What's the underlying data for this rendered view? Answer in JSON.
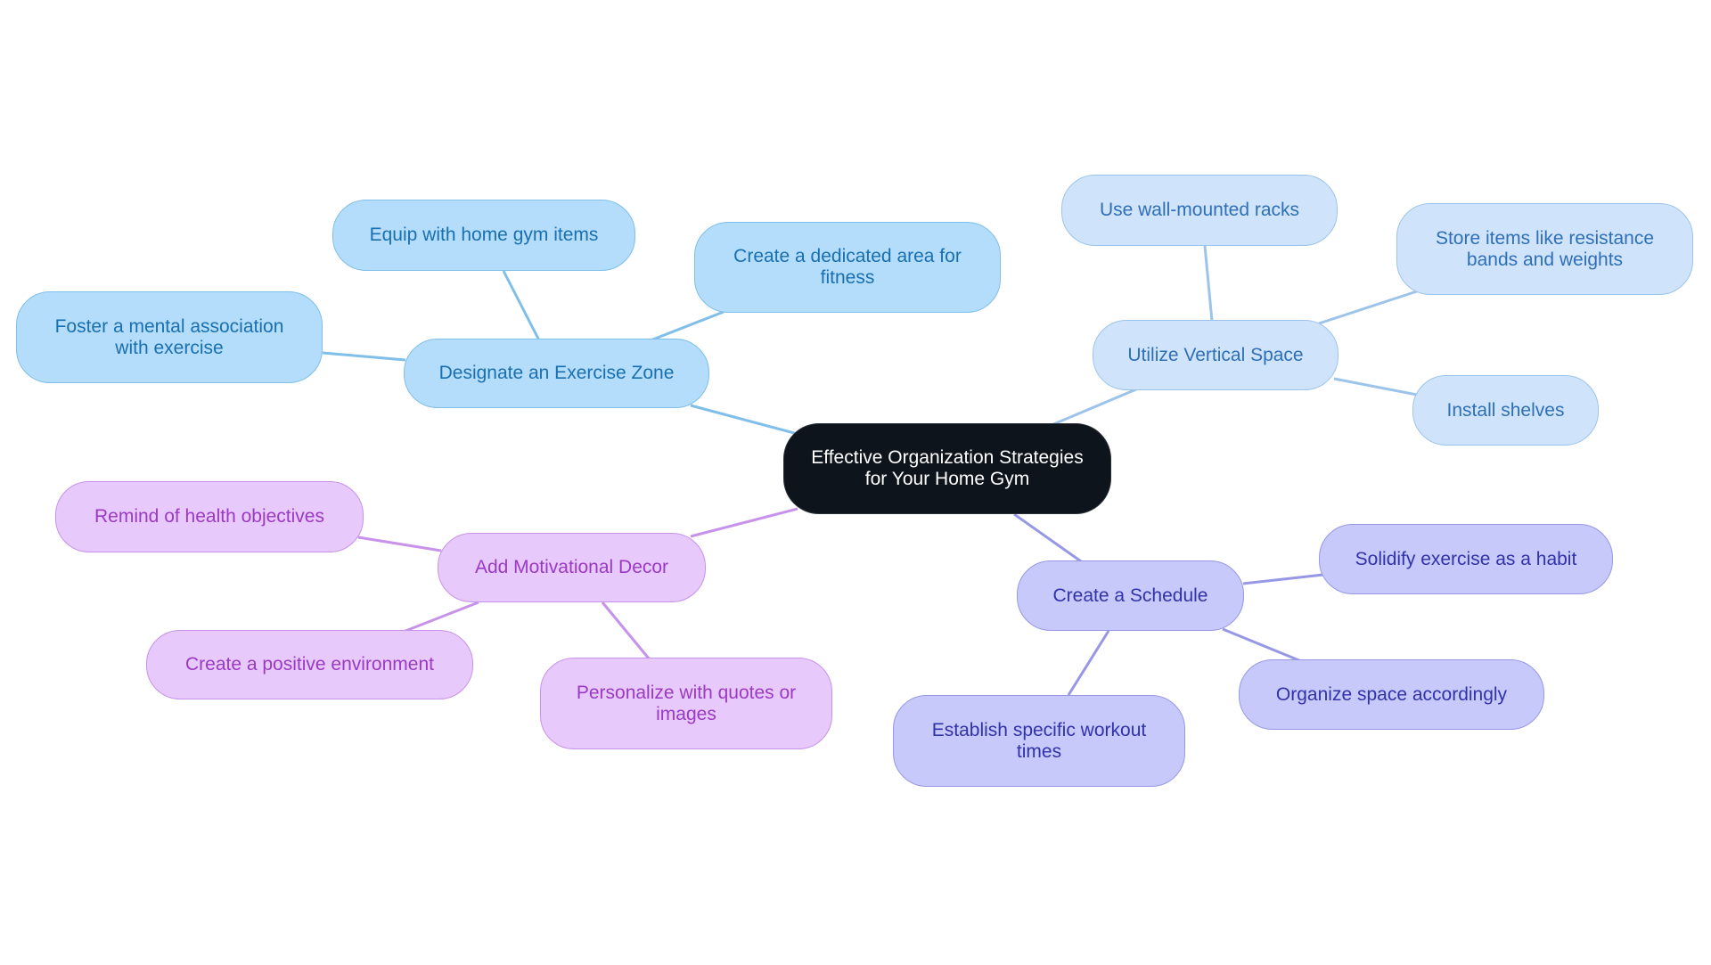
{
  "diagram": {
    "type": "mindmap",
    "root": {
      "id": "root",
      "label": "Effective Organization Strategies for Your Home Gym"
    },
    "branches": [
      {
        "id": "zone",
        "label": "Designate an Exercise Zone",
        "color": "#7fbfe9",
        "children": [
          {
            "id": "zone-equip",
            "label": "Equip with home gym items"
          },
          {
            "id": "zone-dedicated",
            "label": "Create a dedicated area for fitness"
          },
          {
            "id": "zone-foster",
            "label": "Foster a mental association with exercise"
          }
        ]
      },
      {
        "id": "vertical",
        "label": "Utilize Vertical Space",
        "color": "#9cc4ea",
        "children": [
          {
            "id": "vertical-racks",
            "label": "Use wall-mounted racks"
          },
          {
            "id": "vertical-store",
            "label": "Store items like resistance bands and weights"
          },
          {
            "id": "vertical-shelves",
            "label": "Install shelves"
          }
        ]
      },
      {
        "id": "decor",
        "label": "Add Motivational Decor",
        "color": "#c792ea",
        "children": [
          {
            "id": "decor-remind",
            "label": "Remind of health objectives"
          },
          {
            "id": "decor-positive",
            "label": "Create a positive environment"
          },
          {
            "id": "decor-personalize",
            "label": "Personalize with quotes or images"
          }
        ]
      },
      {
        "id": "schedule",
        "label": "Create a Schedule",
        "color": "#9698e6",
        "children": [
          {
            "id": "schedule-solidify",
            "label": "Solidify exercise as a habit"
          },
          {
            "id": "schedule-organize",
            "label": "Organize space accordingly"
          },
          {
            "id": "schedule-establish",
            "label": "Establish specific workout times"
          }
        ]
      }
    ]
  }
}
